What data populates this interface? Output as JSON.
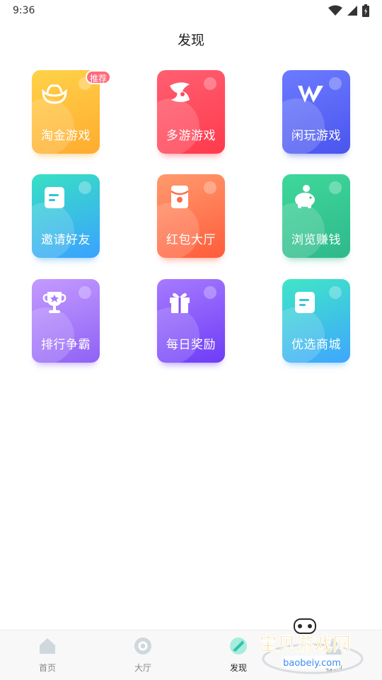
{
  "status_bar": {
    "time": "9:36"
  },
  "header": {
    "title": "发现"
  },
  "badge": {
    "label": "推荐"
  },
  "tiles": [
    {
      "label": "淘金游戏",
      "icon": "gold-ingot-icon",
      "colors": [
        "#ffd24a",
        "#ffab2e"
      ]
    },
    {
      "label": "多游游戏",
      "icon": "fish-logo-icon",
      "colors": [
        "#ff5f72",
        "#ff3a4c"
      ]
    },
    {
      "label": "闲玩游戏",
      "icon": "w-logo-icon",
      "colors": [
        "#6c7bff",
        "#4a55ee"
      ]
    },
    {
      "label": "邀请好友",
      "icon": "document-icon",
      "colors": [
        "#38e0c4",
        "#3aa2ff"
      ]
    },
    {
      "label": "红包大厅",
      "icon": "red-envelope-icon",
      "colors": [
        "#ff9a6e",
        "#ff5c3a"
      ]
    },
    {
      "label": "浏览赚钱",
      "icon": "piggy-bank-icon",
      "colors": [
        "#3ed89a",
        "#2fb88c"
      ]
    },
    {
      "label": "排行争霸",
      "icon": "trophy-icon",
      "colors": [
        "#c39bff",
        "#9062f5"
      ]
    },
    {
      "label": "每日奖励",
      "icon": "gift-icon",
      "colors": [
        "#a67bff",
        "#6e3cf6"
      ]
    },
    {
      "label": "优选商城",
      "icon": "document-icon",
      "colors": [
        "#3fe6c6",
        "#3fa6ff"
      ]
    }
  ],
  "tabbar": {
    "tabs": [
      {
        "label": "首页",
        "icon": "home-icon"
      },
      {
        "label": "大厅",
        "icon": "hall-icon"
      },
      {
        "label": "发现",
        "icon": "discover-icon"
      },
      {
        "label": "我的",
        "icon": "profile-icon"
      }
    ],
    "active_index": 2
  },
  "watermark": {
    "text": "宝贝游戏网",
    "url_text": "baobeiy.com"
  }
}
